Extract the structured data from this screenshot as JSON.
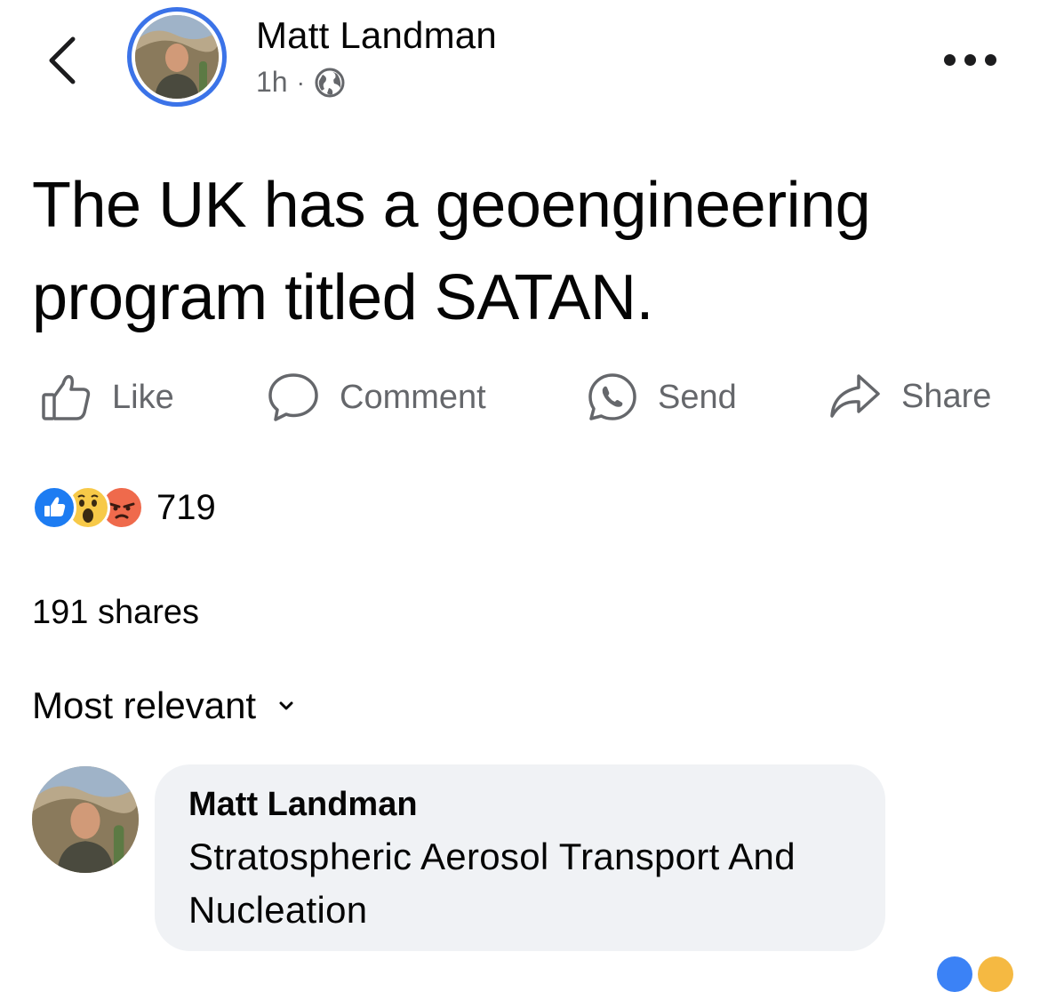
{
  "header": {
    "author_name": "Matt Landman",
    "time_ago": "1h",
    "separator": "·",
    "privacy_icon": "globe-icon"
  },
  "post": {
    "text": "The UK has a geoengineering program titled SATAN."
  },
  "actions": {
    "like_label": "Like",
    "comment_label": "Comment",
    "send_label": "Send",
    "share_label": "Share"
  },
  "reactions": {
    "icons": [
      "like-icon",
      "wow-icon",
      "angry-icon"
    ],
    "count": "719"
  },
  "shares_text": "191 shares",
  "sort_label": "Most relevant",
  "comment": {
    "author_name": "Matt Landman",
    "text": "Stratospheric Aerosol Transport And Nucleation"
  },
  "colors": {
    "accent_blue": "#3b73e8",
    "muted_text": "#65676b",
    "bubble_bg": "#f0f2f5"
  }
}
